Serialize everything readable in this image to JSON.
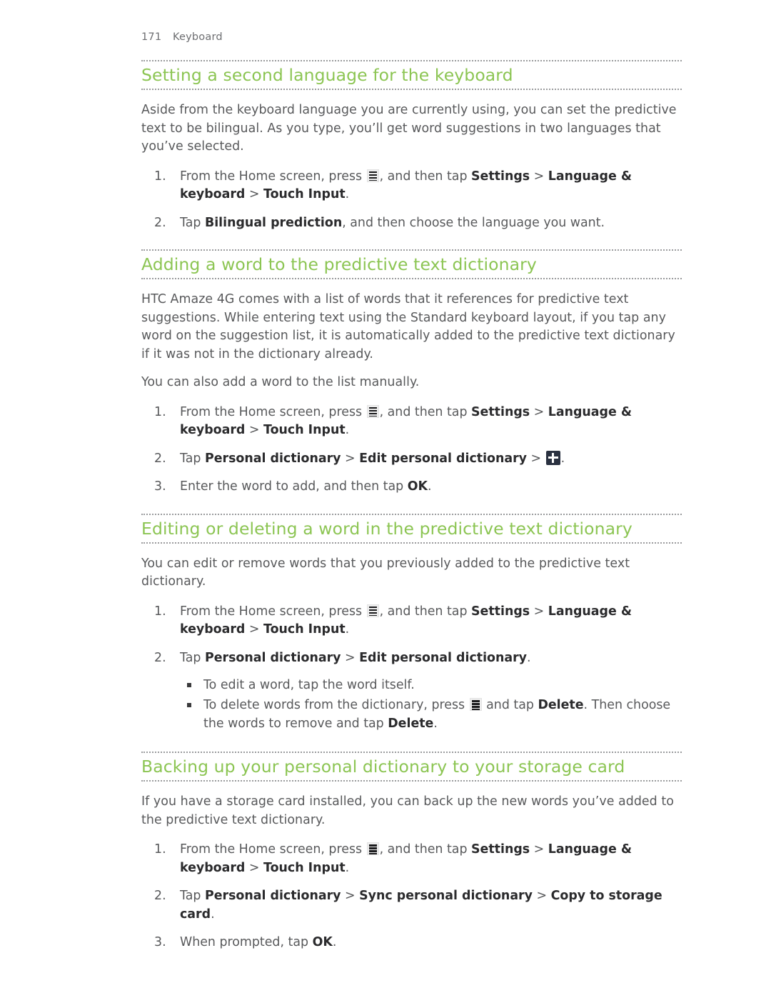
{
  "page": {
    "number": "171",
    "chapter": "Keyboard",
    "accent_color": "#8cc553",
    "body_color": "#58595b",
    "rule_color": "#9a9b9d"
  },
  "icons": {
    "menu": "menu-button-icon",
    "plus": "add-plus-icon"
  },
  "sections": [
    {
      "title": "Setting a second language for the keyboard",
      "paragraphs": [
        "Aside from the keyboard language you are currently using, you can set the predictive text to be bilingual. As you type, you’ll get word suggestions in two languages that you’ve selected."
      ],
      "steps": [
        {
          "number": "1.",
          "parts": [
            {
              "t": "text",
              "v": "From the Home screen, press "
            },
            {
              "t": "icon",
              "v": "menu"
            },
            {
              "t": "text",
              "v": ", and then tap "
            },
            {
              "t": "bold",
              "v": "Settings"
            },
            {
              "t": "text",
              "v": " > "
            },
            {
              "t": "bold",
              "v": "Language & keyboard"
            },
            {
              "t": "text",
              "v": " > "
            },
            {
              "t": "bold",
              "v": "Touch Input"
            },
            {
              "t": "text",
              "v": "."
            }
          ]
        },
        {
          "number": "2.",
          "parts": [
            {
              "t": "text",
              "v": "Tap "
            },
            {
              "t": "bold",
              "v": "Bilingual prediction"
            },
            {
              "t": "text",
              "v": ", and then choose the language you want."
            }
          ]
        }
      ]
    },
    {
      "title": "Adding a word to the predictive text dictionary",
      "paragraphs": [
        "HTC Amaze 4G comes with a list of words that it references for predictive text suggestions. While entering text using the Standard keyboard layout, if you tap any word on the suggestion list, it is automatically added to the predictive text dictionary if it was not in the dictionary already.",
        "You can also add a word to the list manually."
      ],
      "steps": [
        {
          "number": "1.",
          "parts": [
            {
              "t": "text",
              "v": "From the Home screen, press "
            },
            {
              "t": "icon",
              "v": "menu"
            },
            {
              "t": "text",
              "v": ", and then tap "
            },
            {
              "t": "bold",
              "v": "Settings"
            },
            {
              "t": "text",
              "v": " > "
            },
            {
              "t": "bold",
              "v": "Language & keyboard"
            },
            {
              "t": "text",
              "v": " > "
            },
            {
              "t": "bold",
              "v": "Touch Input"
            },
            {
              "t": "text",
              "v": "."
            }
          ]
        },
        {
          "number": "2.",
          "parts": [
            {
              "t": "text",
              "v": "Tap "
            },
            {
              "t": "bold",
              "v": "Personal dictionary"
            },
            {
              "t": "text",
              "v": " > "
            },
            {
              "t": "bold",
              "v": "Edit personal dictionary"
            },
            {
              "t": "text",
              "v": " > "
            },
            {
              "t": "icon",
              "v": "plus"
            },
            {
              "t": "text",
              "v": "."
            }
          ]
        },
        {
          "number": "3.",
          "parts": [
            {
              "t": "text",
              "v": "Enter the word to add, and then tap "
            },
            {
              "t": "bold",
              "v": "OK"
            },
            {
              "t": "text",
              "v": "."
            }
          ]
        }
      ]
    },
    {
      "title": "Editing or deleting a word in the predictive text dictionary",
      "paragraphs": [
        "You can edit or remove words that you previously added to the predictive text dictionary."
      ],
      "steps": [
        {
          "number": "1.",
          "parts": [
            {
              "t": "text",
              "v": "From the Home screen, press "
            },
            {
              "t": "icon",
              "v": "menu"
            },
            {
              "t": "text",
              "v": ", and then tap "
            },
            {
              "t": "bold",
              "v": "Settings"
            },
            {
              "t": "text",
              "v": " > "
            },
            {
              "t": "bold",
              "v": "Language & keyboard"
            },
            {
              "t": "text",
              "v": " > "
            },
            {
              "t": "bold",
              "v": "Touch Input"
            },
            {
              "t": "text",
              "v": "."
            }
          ]
        },
        {
          "number": "2.",
          "parts": [
            {
              "t": "text",
              "v": "Tap "
            },
            {
              "t": "bold",
              "v": "Personal dictionary"
            },
            {
              "t": "text",
              "v": " > "
            },
            {
              "t": "bold",
              "v": "Edit personal dictionary"
            },
            {
              "t": "text",
              "v": "."
            }
          ],
          "sub": [
            {
              "parts": [
                {
                  "t": "text",
                  "v": "To edit a word, tap the word itself."
                }
              ]
            },
            {
              "parts": [
                {
                  "t": "text",
                  "v": "To delete words from the dictionary, press "
                },
                {
                  "t": "icon",
                  "v": "menu"
                },
                {
                  "t": "text",
                  "v": " and tap "
                },
                {
                  "t": "bold",
                  "v": "Delete"
                },
                {
                  "t": "text",
                  "v": ". Then choose the words to remove and tap "
                },
                {
                  "t": "bold",
                  "v": "Delete"
                },
                {
                  "t": "text",
                  "v": "."
                }
              ]
            }
          ]
        }
      ]
    },
    {
      "title": "Backing up your personal dictionary to your storage card",
      "paragraphs": [
        "If you have a storage card installed, you can back up the new words you’ve added to the predictive text dictionary."
      ],
      "steps": [
        {
          "number": "1.",
          "parts": [
            {
              "t": "text",
              "v": "From the Home screen, press "
            },
            {
              "t": "icon",
              "v": "menu"
            },
            {
              "t": "text",
              "v": ", and then tap "
            },
            {
              "t": "bold",
              "v": "Settings"
            },
            {
              "t": "text",
              "v": " > "
            },
            {
              "t": "bold",
              "v": "Language & keyboard"
            },
            {
              "t": "text",
              "v": " > "
            },
            {
              "t": "bold",
              "v": "Touch Input"
            },
            {
              "t": "text",
              "v": "."
            }
          ]
        },
        {
          "number": "2.",
          "parts": [
            {
              "t": "text",
              "v": "Tap "
            },
            {
              "t": "bold",
              "v": "Personal dictionary"
            },
            {
              "t": "text",
              "v": " > "
            },
            {
              "t": "bold",
              "v": "Sync personal dictionary"
            },
            {
              "t": "text",
              "v": " > "
            },
            {
              "t": "bold",
              "v": "Copy to storage card"
            },
            {
              "t": "text",
              "v": "."
            }
          ]
        },
        {
          "number": "3.",
          "parts": [
            {
              "t": "text",
              "v": "When prompted, tap "
            },
            {
              "t": "bold",
              "v": "OK"
            },
            {
              "t": "text",
              "v": "."
            }
          ]
        }
      ]
    }
  ]
}
